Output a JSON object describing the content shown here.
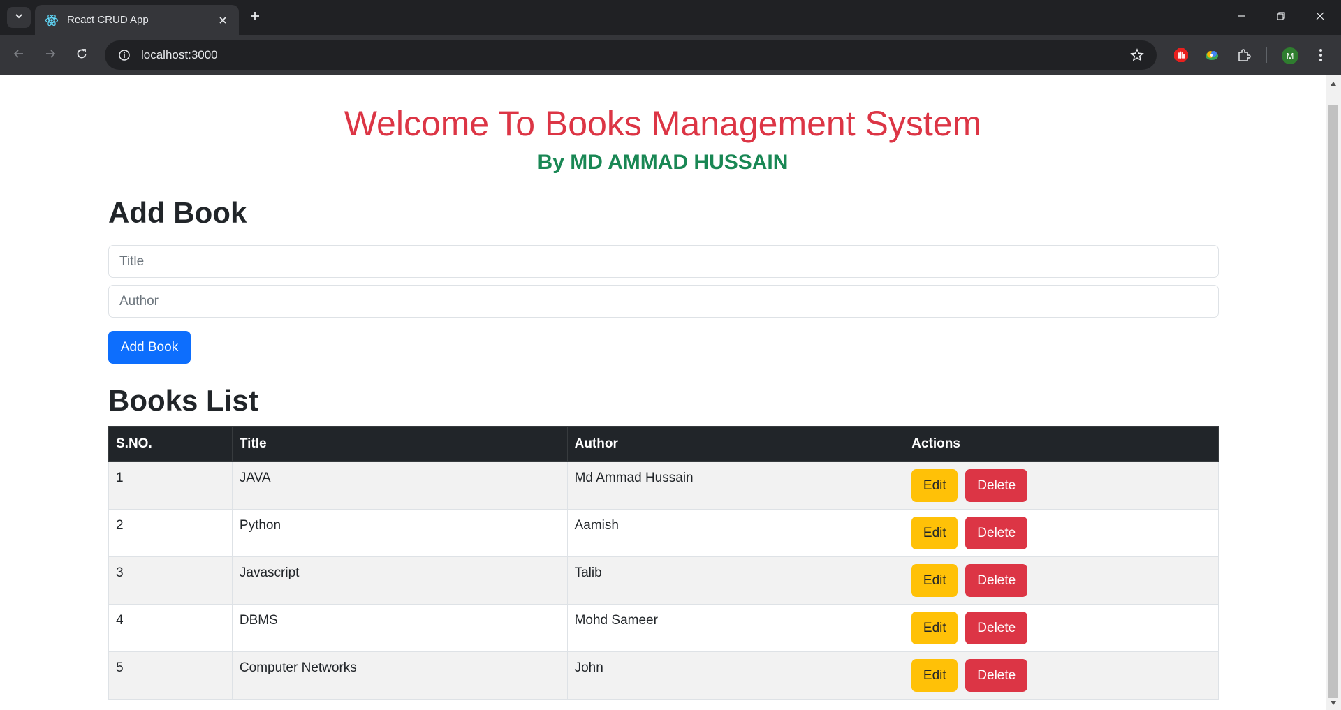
{
  "browser": {
    "tab_title": "React CRUD App",
    "url": "localhost:3000",
    "profile_initial": "M"
  },
  "page": {
    "title": "Welcome To Books Management System",
    "subtitle": "By MD AMMAD HUSSAIN",
    "add_section_heading": "Add Book",
    "title_placeholder": "Title",
    "author_placeholder": "Author",
    "add_button": "Add Book",
    "list_heading": "Books List",
    "table": {
      "headers": [
        "S.NO.",
        "Title",
        "Author",
        "Actions"
      ],
      "rows": [
        {
          "sno": "1",
          "title": "JAVA",
          "author": "Md Ammad Hussain"
        },
        {
          "sno": "2",
          "title": "Python",
          "author": "Aamish"
        },
        {
          "sno": "3",
          "title": "Javascript",
          "author": "Talib"
        },
        {
          "sno": "4",
          "title": "DBMS",
          "author": "Mohd Sameer"
        },
        {
          "sno": "5",
          "title": "Computer Networks",
          "author": "John"
        }
      ],
      "edit_label": "Edit",
      "delete_label": "Delete"
    }
  },
  "colors": {
    "title": "#dc3545",
    "subtitle": "#198754",
    "primary": "#0d6efd",
    "warning": "#ffc107",
    "danger": "#dc3545",
    "table_header": "#212529"
  },
  "icons": {
    "tab_search": "chevron-down-icon",
    "favicon": "react-icon",
    "tab_close": "close-icon",
    "new_tab": "plus-icon",
    "back": "arrow-left-icon",
    "forward": "arrow-right-icon",
    "reload": "reload-icon",
    "site_info": "info-icon",
    "bookmark": "star-icon",
    "extensions": [
      "adblock-icon",
      "extension-color-icon",
      "puzzle-icon"
    ],
    "menu": "kebab-menu-icon"
  }
}
